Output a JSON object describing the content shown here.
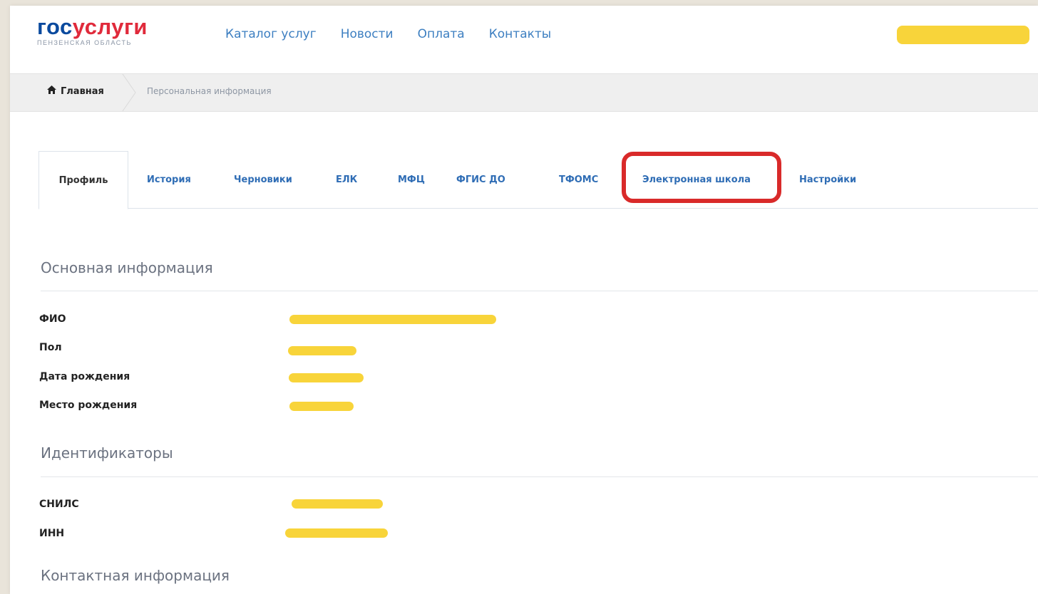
{
  "logo": {
    "part_a": "гос",
    "part_b": "услуги",
    "region": "ПЕНЗЕНСКАЯ ОБЛАСТЬ"
  },
  "topnav": [
    "Каталог услуг",
    "Новости",
    "Оплата",
    "Контакты"
  ],
  "breadcrumb": {
    "home": "Главная",
    "current": "Персональная информация"
  },
  "tabs": [
    "Профиль",
    "История",
    "Черновики",
    "ЕЛК",
    "МФЦ",
    "ФГИС ДО",
    "ТФОМС",
    "Электронная школа",
    "Настройки"
  ],
  "sections": {
    "basic": {
      "title": "Основная информация",
      "fields": [
        "ФИО",
        "Пол",
        "Дата рождения",
        "Место рождения"
      ]
    },
    "ids": {
      "title": "Идентификаторы",
      "fields": [
        "СНИЛС",
        "ИНН"
      ]
    },
    "contact": {
      "title": "Контактная информация"
    }
  },
  "colors": {
    "brand_blue": "#0b4a9e",
    "brand_red": "#e02a3b",
    "link": "#3d7fc1",
    "highlight": "#d92a2a",
    "redaction": "#f8d43a"
  },
  "icons": {
    "breadcrumb_home": "home-icon"
  }
}
